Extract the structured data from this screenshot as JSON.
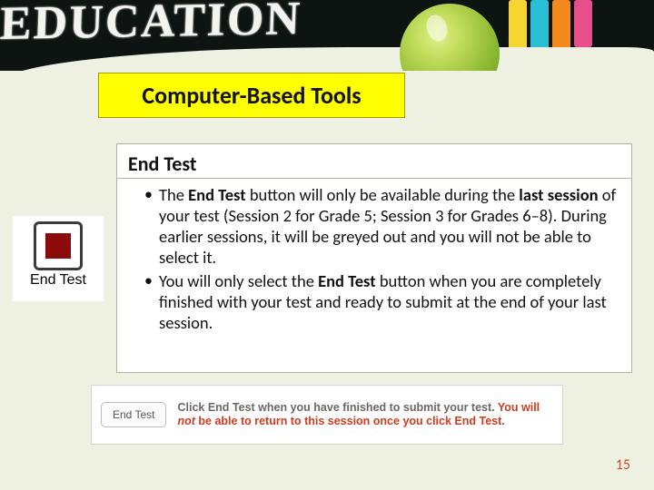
{
  "header": {
    "chalk_word": "EDUCATION"
  },
  "title": "Computer-Based Tools",
  "section_heading": "End Test",
  "end_test_icon": {
    "label": "End Test"
  },
  "bullets": {
    "b1_pre": "The ",
    "b1_bold1": "End Test",
    "b1_mid1": " button will only be available during the ",
    "b1_bold2": "last session",
    "b1_post": " of your test (Session 2 for Grade 5; Session 3 for Grades 6–8). During earlier sessions, it will be greyed out and you will not be able to select it.",
    "b2_pre": "You will only select the ",
    "b2_bold": "End Test",
    "b2_post": " button when you are completely finished with your test and ready to submit at the end of your last session."
  },
  "footer": {
    "button_label": "End Test",
    "grey1": "Click End Test when you have finished to submit your test. ",
    "red1": "You will ",
    "red_italic": "not",
    "red2": " be able to return to this session once you click End Test."
  },
  "page_number": "15"
}
